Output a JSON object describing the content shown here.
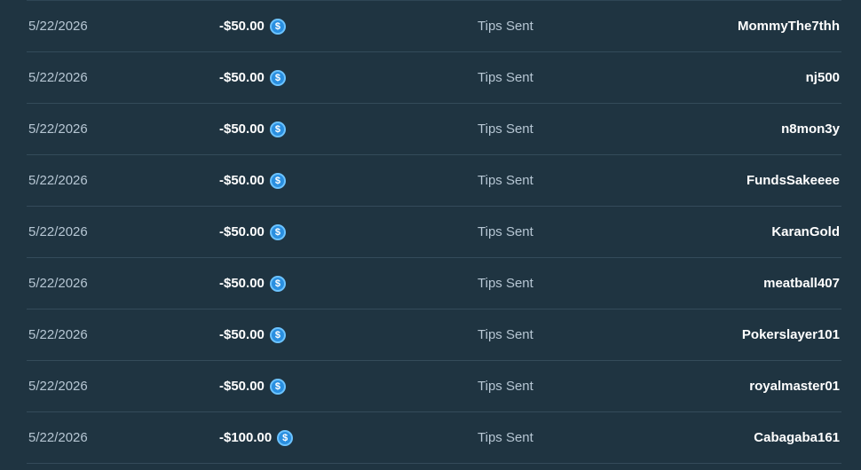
{
  "transactions": [
    {
      "date": "5/22/2026",
      "amount": "-$50.00",
      "currency_icon": "usdc-coin-icon",
      "type": "Tips Sent",
      "user": "MommyThe7thh"
    },
    {
      "date": "5/22/2026",
      "amount": "-$50.00",
      "currency_icon": "usdc-coin-icon",
      "type": "Tips Sent",
      "user": "nj500"
    },
    {
      "date": "5/22/2026",
      "amount": "-$50.00",
      "currency_icon": "usdc-coin-icon",
      "type": "Tips Sent",
      "user": "n8mon3y"
    },
    {
      "date": "5/22/2026",
      "amount": "-$50.00",
      "currency_icon": "usdc-coin-icon",
      "type": "Tips Sent",
      "user": "FundsSakeeee"
    },
    {
      "date": "5/22/2026",
      "amount": "-$50.00",
      "currency_icon": "usdc-coin-icon",
      "type": "Tips Sent",
      "user": "KaranGold"
    },
    {
      "date": "5/22/2026",
      "amount": "-$50.00",
      "currency_icon": "usdc-coin-icon",
      "type": "Tips Sent",
      "user": "meatball407"
    },
    {
      "date": "5/22/2026",
      "amount": "-$50.00",
      "currency_icon": "usdc-coin-icon",
      "type": "Tips Sent",
      "user": "Pokerslayer101"
    },
    {
      "date": "5/22/2026",
      "amount": "-$50.00",
      "currency_icon": "usdc-coin-icon",
      "type": "Tips Sent",
      "user": "royalmaster01"
    },
    {
      "date": "5/22/2026",
      "amount": "-$100.00",
      "currency_icon": "usdc-coin-icon",
      "type": "Tips Sent",
      "user": "Cabagaba161"
    }
  ],
  "colors": {
    "background": "#1f3441",
    "muted_text": "#b6c6d3",
    "primary_text": "#ffffff",
    "divider": "#344b5a",
    "coin": "#2a8fe0"
  }
}
